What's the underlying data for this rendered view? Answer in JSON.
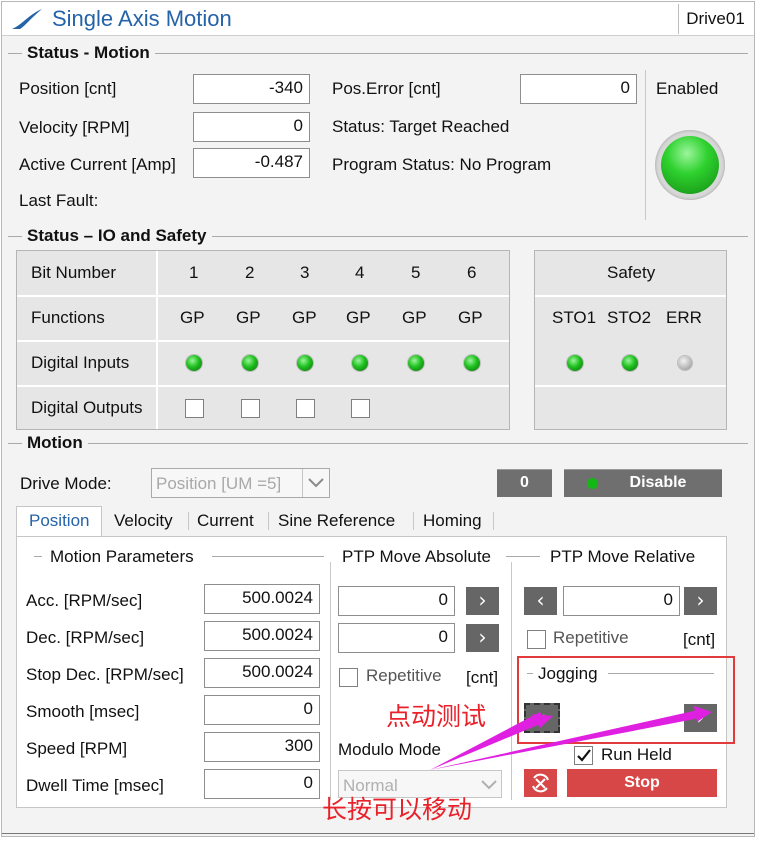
{
  "window": {
    "title": "Single Axis Motion",
    "drive": "Drive01"
  },
  "status_motion": {
    "header": "Status - Motion",
    "position_label": "Position  [cnt]",
    "position_value": "-340",
    "velocity_label": "Velocity  [RPM]",
    "velocity_value": "0",
    "current_label": "Active Current [Amp]",
    "current_value": "-0.487",
    "last_fault_label": "Last Fault:",
    "pos_error_label": "Pos.Error   [cnt]",
    "pos_error_value": "0",
    "status_text": "Status: Target Reached",
    "program_status_text": "Program Status: No Program",
    "enabled_label": "Enabled"
  },
  "io_safety": {
    "header": "Status – IO and Safety",
    "row_labels": [
      "Bit Number",
      "Functions",
      "Digital Inputs",
      "Digital Outputs"
    ],
    "bits": [
      "1",
      "2",
      "3",
      "4",
      "5",
      "6"
    ],
    "functions": [
      "GP",
      "GP",
      "GP",
      "GP",
      "GP",
      "GP"
    ],
    "safety_header": "Safety",
    "safety_items": [
      "STO1",
      "STO2",
      "ERR"
    ]
  },
  "motion": {
    "header": "Motion",
    "drive_mode_label": "Drive Mode:",
    "drive_mode_value": "Position [UM =5]",
    "counter_button": "0",
    "disable_button": "Disable",
    "tabs": [
      "Position",
      "Velocity",
      "Current",
      "Sine Reference",
      "Homing"
    ],
    "params_header": "Motion Parameters",
    "params": [
      {
        "label": "Acc. [RPM/sec]",
        "value": "500.0024"
      },
      {
        "label": "Dec. [RPM/sec]",
        "value": "500.0024"
      },
      {
        "label": "Stop Dec. [RPM/sec]",
        "value": "500.0024"
      },
      {
        "label": "Smooth [msec]",
        "value": "0"
      },
      {
        "label": "Speed [RPM]",
        "value": "300"
      },
      {
        "label": "Dwell Time [msec]",
        "value": "0"
      }
    ],
    "ptp_abs_header": "PTP Move Absolute",
    "ptp_abs_values": [
      "0",
      "0"
    ],
    "repetitive_label": "Repetitive",
    "cnt_unit": "[cnt]",
    "modulo_label": "Modulo Mode",
    "modulo_value": "Normal",
    "ptp_rel_header": "PTP Move Relative",
    "ptp_rel_value": "0",
    "jogging_header": "Jogging",
    "run_held_label": "Run Held",
    "stop_button": "Stop"
  },
  "annotations": {
    "jog_test": "点动测试",
    "long_press": "长按可以移动",
    "color": "#e8212a",
    "arrow_color": "#e020e0"
  }
}
